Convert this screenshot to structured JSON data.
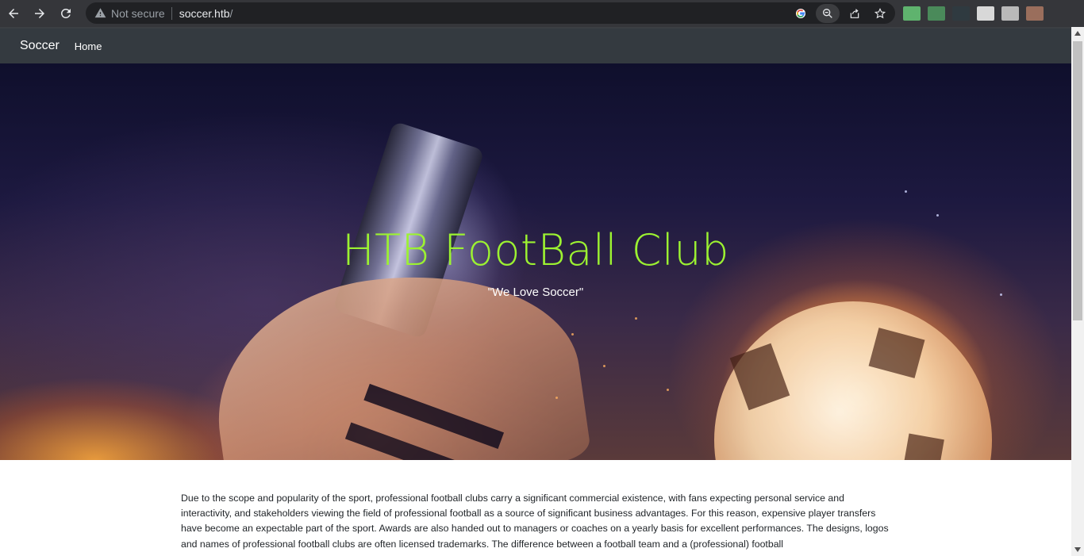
{
  "browser": {
    "security_label": "Not secure",
    "url_host": "soccer.htb",
    "url_path": "/",
    "extension_colors": [
      "#5fb36e",
      "#4a8a5a",
      "#2f3a40",
      "#d8d8d8",
      "#b9b9b9",
      "#9a6e5c"
    ]
  },
  "site": {
    "brand": "Soccer",
    "nav": {
      "home_label": "Home"
    },
    "hero": {
      "title": "HTB FootBall Club",
      "subtitle": "\"We Love Soccer\"",
      "title_color": "#9cf231"
    },
    "content": {
      "paragraph": "Due to the scope and popularity of the sport, professional football clubs carry a significant commercial existence, with fans expecting personal service and interactivity, and stakeholders viewing the field of professional football as a source of significant business advantages. For this reason, expensive player transfers have become an expectable part of the sport. Awards are also handed out to managers or coaches on a yearly basis for excellent performances. The designs, logos and names of professional football clubs are often licensed trademarks. The difference between a football team and a (professional) football"
    }
  }
}
